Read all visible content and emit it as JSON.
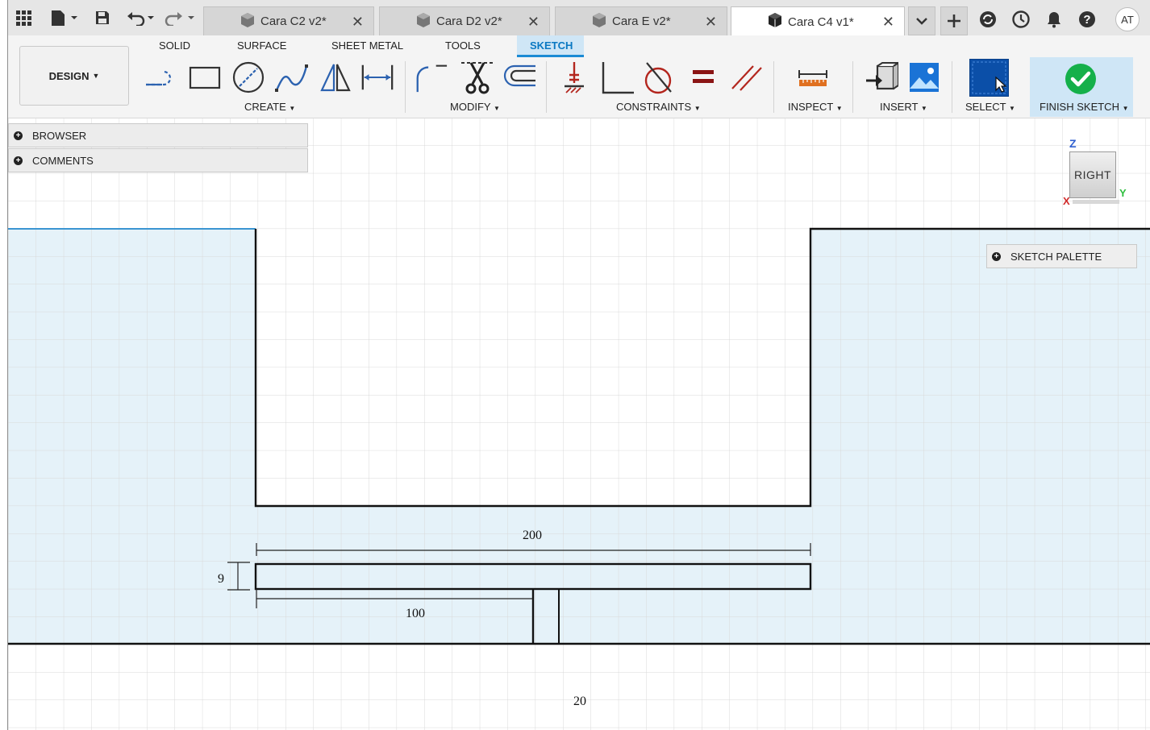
{
  "tabs": [
    {
      "label": "Cara C2 v2*",
      "active": false
    },
    {
      "label": "Cara D2 v2*",
      "active": false
    },
    {
      "label": "Cara E v2*",
      "active": false
    },
    {
      "label": "Cara C4 v1*",
      "active": true
    }
  ],
  "user": {
    "initials": "AT"
  },
  "toolbar": {
    "design_label": "DESIGN",
    "workspace_tabs": [
      "SOLID",
      "SURFACE",
      "SHEET METAL",
      "TOOLS",
      "SKETCH"
    ],
    "active_workspace": "SKETCH",
    "groups": {
      "create": "CREATE",
      "modify": "MODIFY",
      "constraints": "CONSTRAINTS",
      "inspect": "INSPECT",
      "insert": "INSERT",
      "select": "SELECT",
      "finish": "FINISH SKETCH"
    }
  },
  "panels": {
    "browser": "BROWSER",
    "comments": "COMMENTS",
    "sketch_palette": "SKETCH PALETTE"
  },
  "viewcube": {
    "face": "RIGHT",
    "axis_z": "Z",
    "axis_y": "Y",
    "axis_x": "X"
  },
  "sketch": {
    "dimensions": {
      "width_top": "200",
      "height_left": "9",
      "width_bottom": "100",
      "lower": "20"
    }
  },
  "colors": {
    "accent": "#0a78c2",
    "region_fill": "#e5f2f9",
    "finish_green": "#15b04a",
    "select_blue": "#0b4fa8"
  }
}
